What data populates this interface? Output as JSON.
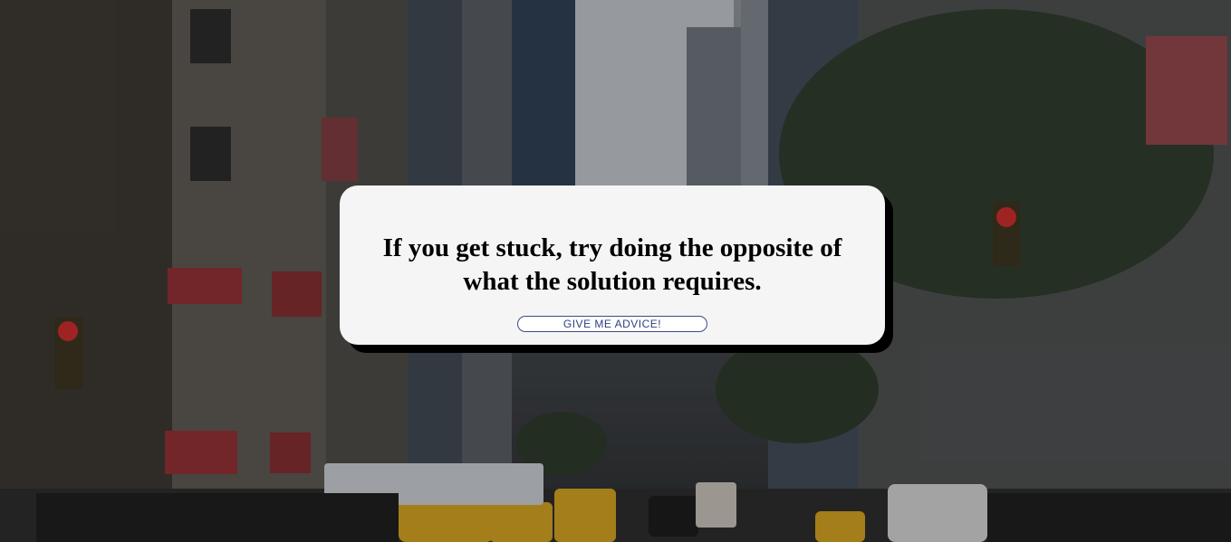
{
  "card": {
    "advice": "If you get stuck, try doing the opposite of what the solution requires.",
    "button_label": "GIVE ME ADVICE!"
  },
  "colors": {
    "card_background": "#f5f5f6",
    "card_shadow": "#000000",
    "button_border": "#3b4b8a",
    "button_text": "#2f3f80"
  }
}
